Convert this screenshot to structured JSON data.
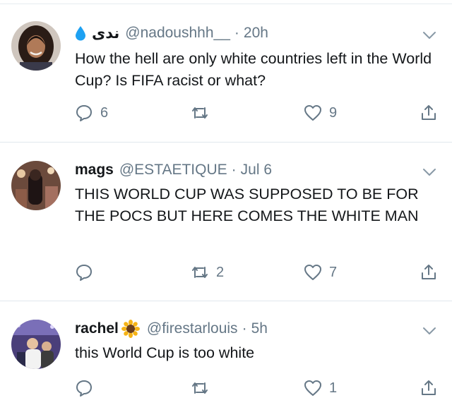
{
  "tweets": [
    {
      "name": "",
      "name_emoji": "water-drop-icon",
      "display_name_ar": "ندى",
      "handle": "@nadoushhh__",
      "time": "20h",
      "text": "How the hell are only white countries left in the World Cup? Is FIFA racist or what?",
      "reply_count": "6",
      "retweet_count": "",
      "like_count": "9"
    },
    {
      "name": "mags",
      "handle": "@ESTAETIQUE",
      "time": "Jul 6",
      "text": "THIS WORLD CUP WAS SUPPOSED TO BE FOR THE POCS BUT HERE COMES THE WHITE MAN",
      "reply_count": "",
      "retweet_count": "2",
      "like_count": "7"
    },
    {
      "name": "rachel",
      "name_emoji": "sunflower-icon",
      "handle": "@firestarlouis",
      "time": "5h",
      "text": "this World Cup is too white",
      "reply_count": "",
      "retweet_count": "",
      "like_count": "1"
    }
  ],
  "separator": "·",
  "colors": {
    "text": "#14171a",
    "muted": "#657786",
    "divider": "#e1e8ed",
    "water_drop": "#1da1f2",
    "sunflower_petal": "#f5b316",
    "sunflower_center": "#6b3f1d"
  }
}
